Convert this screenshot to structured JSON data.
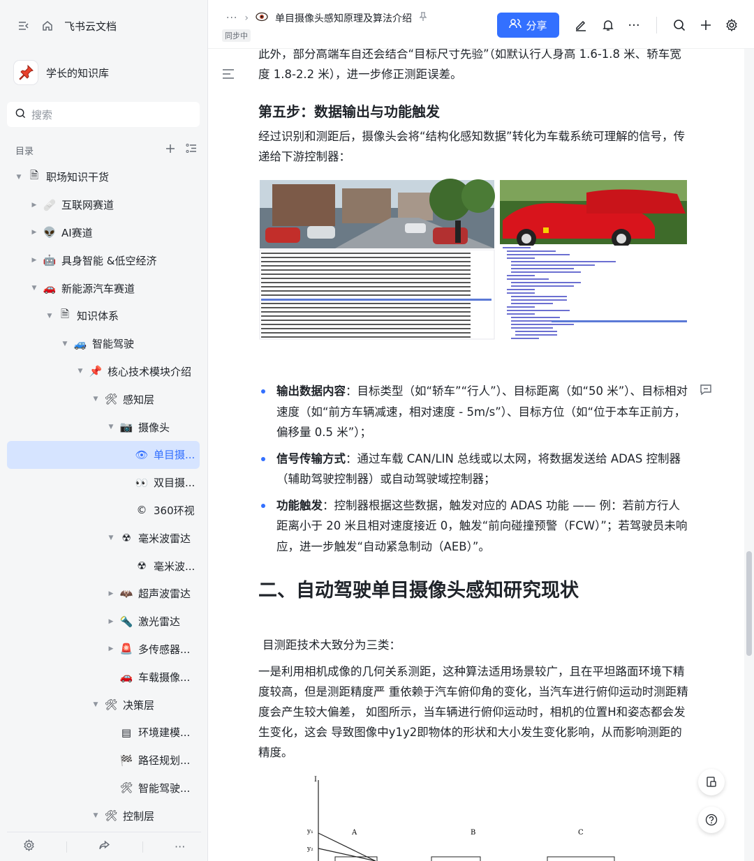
{
  "sidebar": {
    "app_title": "飞书云文档",
    "knowledge_base": "学长的知识库",
    "search_placeholder": "搜索",
    "toc_label": "目录",
    "tree": [
      {
        "label": "职场知识干货",
        "depth": 0,
        "arrow": "down",
        "icon": "doc-icon",
        "glyph": "🗎"
      },
      {
        "label": "互联网赛道",
        "depth": 1,
        "arrow": "right",
        "icon": "bandage-icon",
        "glyph": "🩹"
      },
      {
        "label": "AI赛道",
        "depth": 1,
        "arrow": "right",
        "icon": "alien-icon",
        "glyph": "👽"
      },
      {
        "label": "具身智能 &低空经济",
        "depth": 1,
        "arrow": "right",
        "icon": "robot-icon",
        "glyph": "🤖"
      },
      {
        "label": "新能源汽车赛道",
        "depth": 1,
        "arrow": "down",
        "icon": "car-icon",
        "glyph": "🚗"
      },
      {
        "label": "知识体系",
        "depth": 2,
        "arrow": "down",
        "icon": "doc-icon",
        "glyph": "🗎"
      },
      {
        "label": "智能驾驶",
        "depth": 3,
        "arrow": "down",
        "icon": "car-icon",
        "glyph": "🚙"
      },
      {
        "label": "核心技术模块介绍",
        "depth": 4,
        "arrow": "down",
        "icon": "pin-icon",
        "glyph": "📌"
      },
      {
        "label": "感知层",
        "depth": 5,
        "arrow": "down",
        "icon": "tools-icon",
        "glyph": "🛠"
      },
      {
        "label": "摄像头",
        "depth": 6,
        "arrow": "down",
        "icon": "camera-icon",
        "glyph": "📷"
      },
      {
        "label": "单目摄...",
        "depth": 7,
        "arrow": "",
        "icon": "eye-icon",
        "glyph": "👁",
        "active": true
      },
      {
        "label": "双目摄...",
        "depth": 7,
        "arrow": "",
        "icon": "eyes-icon",
        "glyph": "👀"
      },
      {
        "label": "360环视",
        "depth": 7,
        "arrow": "",
        "icon": "copyright-icon",
        "glyph": "©"
      },
      {
        "label": "毫米波雷达",
        "depth": 6,
        "arrow": "down",
        "icon": "radiation-icon",
        "glyph": "☢"
      },
      {
        "label": "毫米波...",
        "depth": 7,
        "arrow": "",
        "icon": "radiation-icon",
        "glyph": "☢"
      },
      {
        "label": "超声波雷达",
        "depth": 6,
        "arrow": "right",
        "icon": "bat-icon",
        "glyph": "🦇"
      },
      {
        "label": "激光雷达",
        "depth": 6,
        "arrow": "right",
        "icon": "laser-icon",
        "glyph": "🔦"
      },
      {
        "label": "多传感器...",
        "depth": 6,
        "arrow": "right",
        "icon": "siren-icon",
        "glyph": "🚨"
      },
      {
        "label": "车载摄像...",
        "depth": 6,
        "arrow": "",
        "icon": "car-icon",
        "glyph": "🚗"
      },
      {
        "label": "决策层",
        "depth": 5,
        "arrow": "down",
        "icon": "tools-icon",
        "glyph": "🛠"
      },
      {
        "label": "环境建模...",
        "depth": 6,
        "arrow": "",
        "icon": "doc-icon",
        "glyph": "▤"
      },
      {
        "label": "路径规划...",
        "depth": 6,
        "arrow": "",
        "icon": "flag-icon",
        "glyph": "🏁"
      },
      {
        "label": "智能驾驶...",
        "depth": 6,
        "arrow": "",
        "icon": "tools-icon",
        "glyph": "🛠"
      },
      {
        "label": "控制层",
        "depth": 5,
        "arrow": "down",
        "icon": "tools-icon",
        "glyph": "🛠"
      }
    ]
  },
  "header": {
    "doc_title": "单目摄像头感知原理及算法介绍",
    "sync_status": "同步中",
    "share_label": "分享"
  },
  "content": {
    "para_top": "此外，部分高端车自还会结合“目标尺寸先验”（如默认行人身高 1.6-1.8 米、轿车宽度 1.8-2.2 米），进一步修正测距误差。",
    "step5_title": "第五步：数据输出与功能触发",
    "step5_intro": "经过识别和测距后，摄像头会将“结构化感知数据”转化为车载系统可理解的信号，传递给下游控制器：",
    "bullets": [
      {
        "bold": "输出数据内容",
        "text": "：目标类型（如“轿车”“行人”）、目标距离（如“50 米”）、目标相对速度（如“前方车辆减速，相对速度 - 5m/s”）、目标方位（如“位于本车正前方，偏移量 0.5 米”）；"
      },
      {
        "bold": "信号传输方式",
        "text": "：通过车载 CAN/LIN 总线或以太网，将数据发送给 ADAS 控制器（辅助驾驶控制器）或自动驾驶域控制器；"
      },
      {
        "bold": "功能触发",
        "text": "：控制器根据这些数据，触发对应的 ADAS 功能 —— 例：若前方行人距离小于 20 米且相对速度接近 0，触发“前向碰撞预警（FCW）”；若驾驶员未响应，进一步触发“自动紧急制动（AEB）”。"
      }
    ],
    "section2_title": "二、自动驾驶单目摄像头感知研究现状",
    "section2_intro": "目测距技术大致分为三类：",
    "section2_para": "一是利用相机成像的几何关系测距，这种算法适用场景较广，且在平坦路面环境下精度较高，但是测距精度严 重依赖于汽车俯仰角的变化，当汽车进行俯仰运动时测距精度会产生较大偏差， 如图所示，当车辆进行俯仰运动时，相机的位置H和姿态都会发生变化，这会 导致图像中y1y2即物体的形状和大小发生变化影响，从而影响测距的精度。",
    "diagram_labels": {
      "axis": "I",
      "y1": "y₁",
      "y2": "y₂",
      "a": "A",
      "b": "B",
      "c": "C"
    }
  }
}
